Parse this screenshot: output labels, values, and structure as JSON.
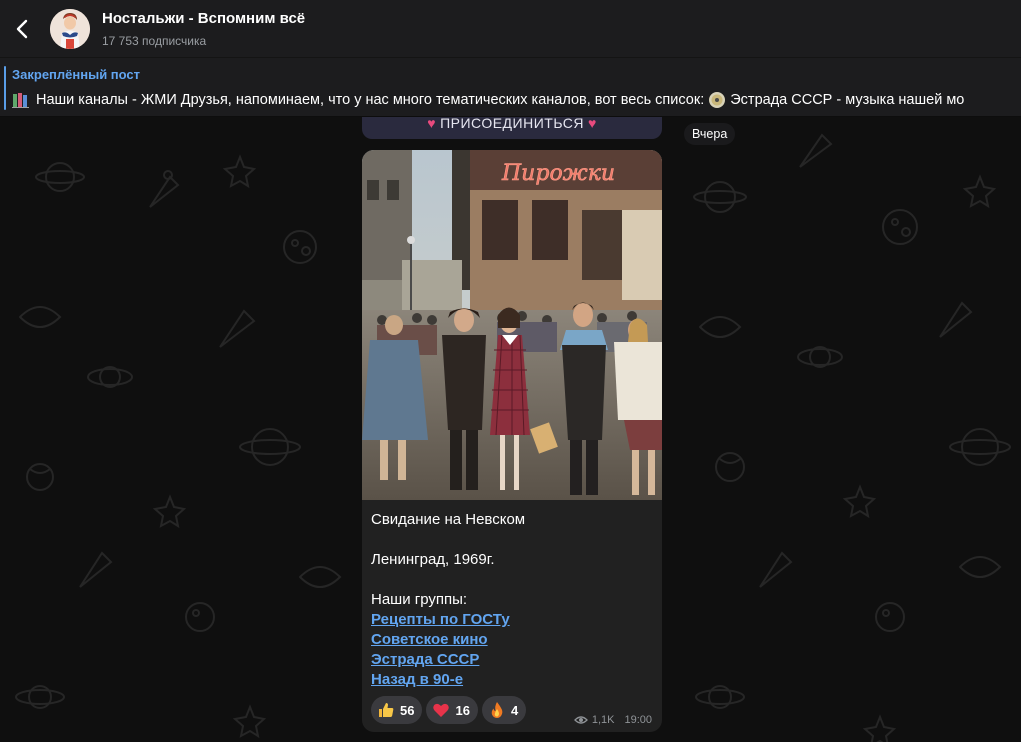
{
  "header": {
    "title": "Ностальжи - Вспомним всё",
    "subscribers": "17 753 подписчика"
  },
  "pinned": {
    "label": "Закреплённый пост",
    "text_part1": "Наши каналы - ЖМИ Друзья, напоминаем, что у нас много тематических каналов, вот весь список:",
    "text_part2": "Эстрада СССР - музыка нашей мо"
  },
  "chat": {
    "join_label": "ПРИСОЕДИНИТЬСЯ",
    "date_chip": "Вчера",
    "message": {
      "line1": "Свидание на Невском",
      "line2": "Ленинград, 1969г.",
      "groups_label": "Наши группы:",
      "links": [
        "Рецепты по ГОСТу",
        "Советское кино",
        "Эстрада СССР",
        "Назад в 90-е"
      ],
      "reactions": [
        {
          "icon": "thumbs-up-icon",
          "count": "56"
        },
        {
          "icon": "heart-icon",
          "count": "16"
        },
        {
          "icon": "fire-icon",
          "count": "4"
        }
      ],
      "views": "1,1K",
      "time": "19:00"
    }
  },
  "colors": {
    "accent": "#62a5f0",
    "header_bg": "#1c1c1e",
    "bubble_bg": "#212121",
    "heart": "#e84a7e"
  }
}
